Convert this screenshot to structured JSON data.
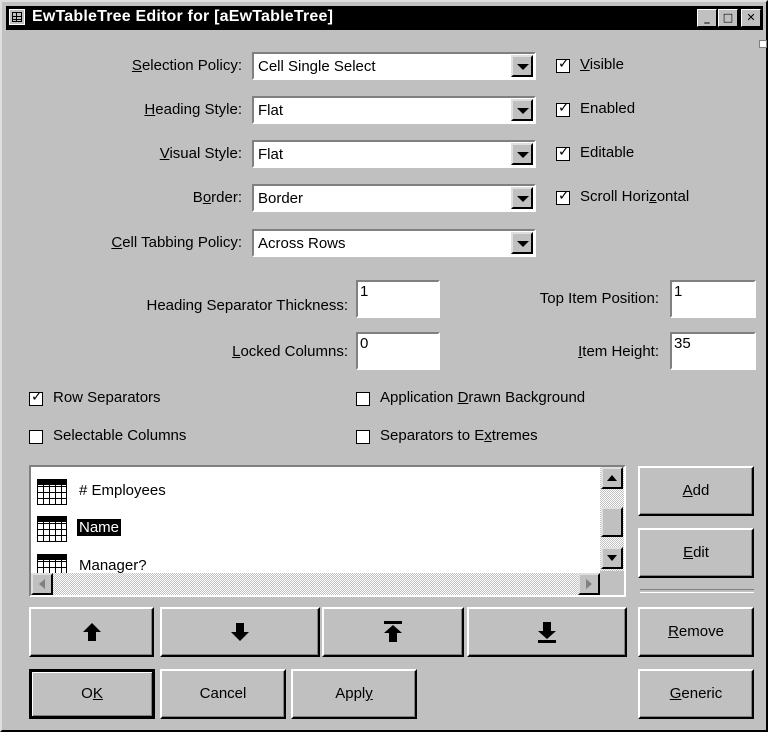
{
  "window": {
    "title": "EwTableTree Editor for [aEwTableTree]"
  },
  "titlebar_buttons": {
    "minimize": "_",
    "maximize": "□",
    "close": "✕"
  },
  "properties": {
    "selection_policy": {
      "pre": "",
      "key": "S",
      "post": "election Policy:",
      "value": "Cell Single Select"
    },
    "heading_style": {
      "pre": "",
      "key": "H",
      "post": "eading Style:",
      "value": "Flat"
    },
    "visual_style": {
      "pre": "",
      "key": "V",
      "post": "isual Style:",
      "value": "Flat"
    },
    "border": {
      "pre": "B",
      "key": "o",
      "post": "rder:",
      "value": "Border"
    },
    "cell_tabbing_policy": {
      "pre": "",
      "key": "C",
      "post": "ell Tabbing Policy:",
      "value": "Across Rows"
    }
  },
  "flags": {
    "visible": {
      "pre": "",
      "key": "V",
      "post": "isible",
      "checked": true
    },
    "enabled": {
      "pre": "",
      "key": "",
      "post": "Enabled",
      "checked": true
    },
    "editable": {
      "pre": "",
      "key": "",
      "post": "Editable",
      "checked": true
    },
    "scroll_horizontal": {
      "pre": "Scroll Hori",
      "key": "z",
      "post": "ontal",
      "checked": true
    }
  },
  "numbers": {
    "heading_separator_thickness": {
      "label": "Heading Separator Thickness:",
      "value": "1"
    },
    "locked_columns": {
      "pre": "",
      "key": "L",
      "post": "ocked Columns:",
      "value": "0"
    },
    "top_item_position": {
      "label": "Top Item Position:",
      "value": "1"
    },
    "item_height": {
      "pre": "",
      "key": "I",
      "post": "tem Height:",
      "value": "35"
    }
  },
  "options": {
    "row_separators": {
      "label": "Row Separators",
      "checked": true
    },
    "selectable_columns": {
      "label": "Selectable Columns",
      "checked": false
    },
    "app_drawn_bg": {
      "pre": "Application ",
      "key": "D",
      "post": "rawn Background",
      "checked": false
    },
    "separators_to_extremes": {
      "pre": "Separators to E",
      "key": "x",
      "post": "tremes",
      "checked": false
    }
  },
  "columns_list": {
    "items": [
      {
        "label": "# Employees",
        "selected": false
      },
      {
        "label": "Name",
        "selected": true
      },
      {
        "label": "Manager?",
        "selected": false
      }
    ]
  },
  "side_buttons": {
    "add": {
      "pre": "",
      "key": "A",
      "post": "dd"
    },
    "edit": {
      "pre": "",
      "key": "E",
      "post": "dit"
    },
    "remove": {
      "pre": "",
      "key": "R",
      "post": "emove"
    },
    "generic": {
      "pre": "",
      "key": "G",
      "post": "eneric"
    }
  },
  "move_buttons": [
    "move-up",
    "move-down",
    "move-to-top",
    "move-to-bottom"
  ],
  "dialog_buttons": {
    "ok": {
      "pre": "O",
      "key": "K",
      "post": ""
    },
    "cancel": {
      "pre": "",
      "key": "",
      "post": "Cancel"
    },
    "apply": {
      "pre": "Appl",
      "key": "y",
      "post": ""
    }
  },
  "colors": {
    "face": "#c0c0c0",
    "selection": "#000000"
  }
}
